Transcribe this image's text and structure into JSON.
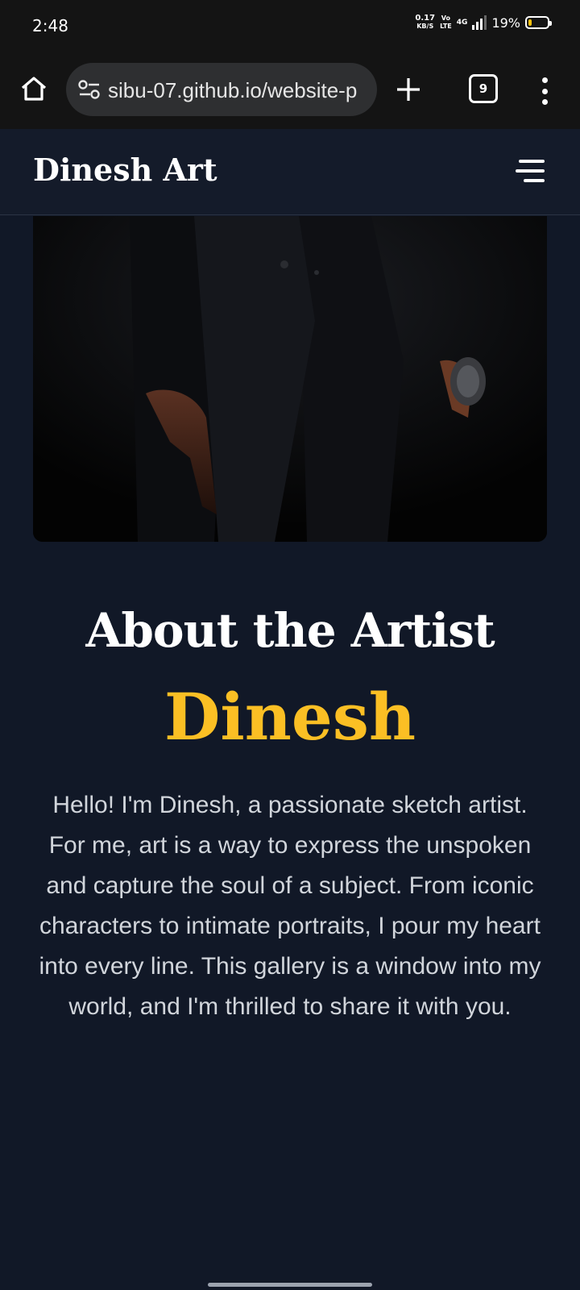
{
  "status_bar": {
    "time": "2:48",
    "net_speed_value": "0.17",
    "net_speed_unit": "KB/S",
    "volte_top": "Vo",
    "volte_bottom": "LTE",
    "network": "4G",
    "battery": "19%",
    "battery_level": 0.19
  },
  "browser": {
    "url": "sibu-07.github.io/website-p",
    "tab_count": "9",
    "icons": [
      "home-icon",
      "site-settings-icon",
      "plus-icon",
      "tabs-icon",
      "more-vert-icon"
    ]
  },
  "site": {
    "brand": "Dinesh Art",
    "menu_icon": "hamburger-icon"
  },
  "about": {
    "title": "About the Artist",
    "name": "Dinesh",
    "bio": "Hello! I'm Dinesh, a passionate sketch artist. For me, art is a way to express the unspoken and capture the soul of a subject. From iconic characters to intimate portraits, I pour my heart into every line. This gallery is a window into my world, and I'm thrilled to share it with you."
  },
  "colors": {
    "page_bg": "#111827",
    "header_bg": "#141b2a",
    "accent": "#fbbf24",
    "body_text": "#d1d5db"
  }
}
